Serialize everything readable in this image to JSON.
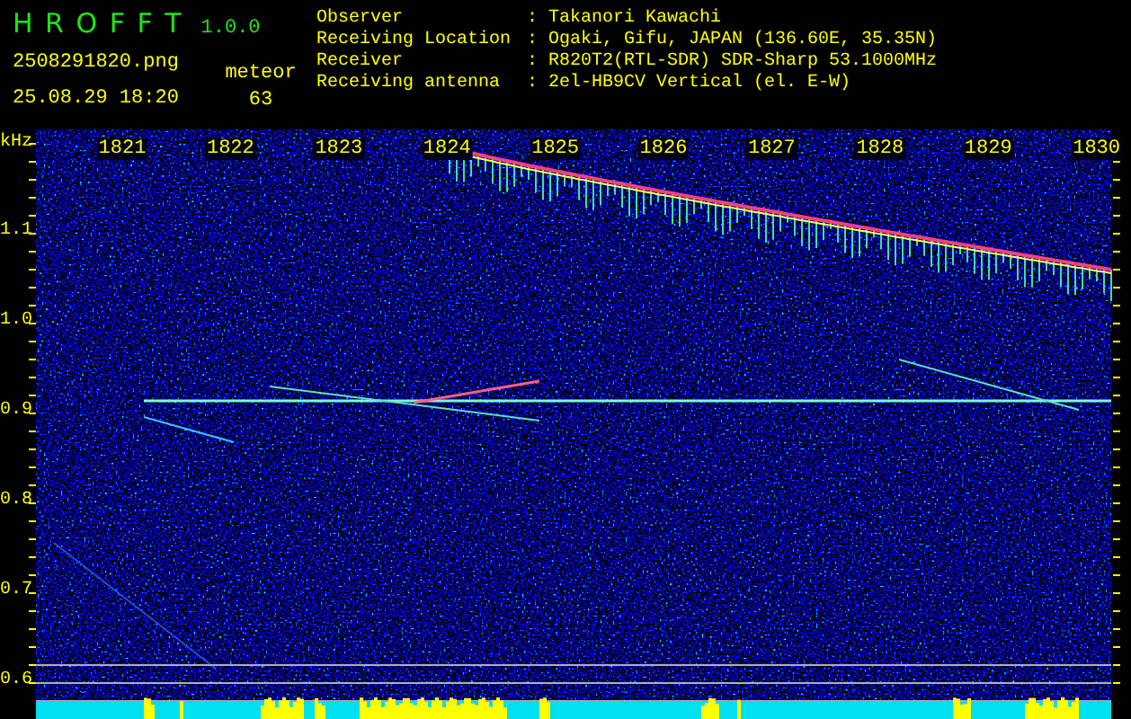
{
  "app": {
    "title": "H R O F F T",
    "version": "1.0.0"
  },
  "file": {
    "name": "2508291820.png",
    "datetime": "25.08.29 18:20"
  },
  "meteor": {
    "label": "meteor",
    "count": "63"
  },
  "station": [
    {
      "label": "Observer",
      "value": ": Takanori Kawachi"
    },
    {
      "label": "Receiving Location",
      "value": ": Ogaki, Gifu, JAPAN (136.60E, 35.35N)"
    },
    {
      "label": "Receiver",
      "value": ": R820T2(RTL-SDR) SDR-Sharp 53.1000MHz"
    },
    {
      "label": "Receiving antenna",
      "value": ": 2el-HB9CV Vertical (el. E-W)"
    }
  ],
  "spectrogram": {
    "unit": "kHz",
    "time_labels": [
      "1821",
      "1822",
      "1823",
      "1824",
      "1825",
      "1826",
      "1827",
      "1828",
      "1829",
      "1830"
    ],
    "freq_labels": [
      "1.1",
      "1.0",
      "0.9",
      "0.8",
      "0.7",
      "0.6"
    ]
  }
}
